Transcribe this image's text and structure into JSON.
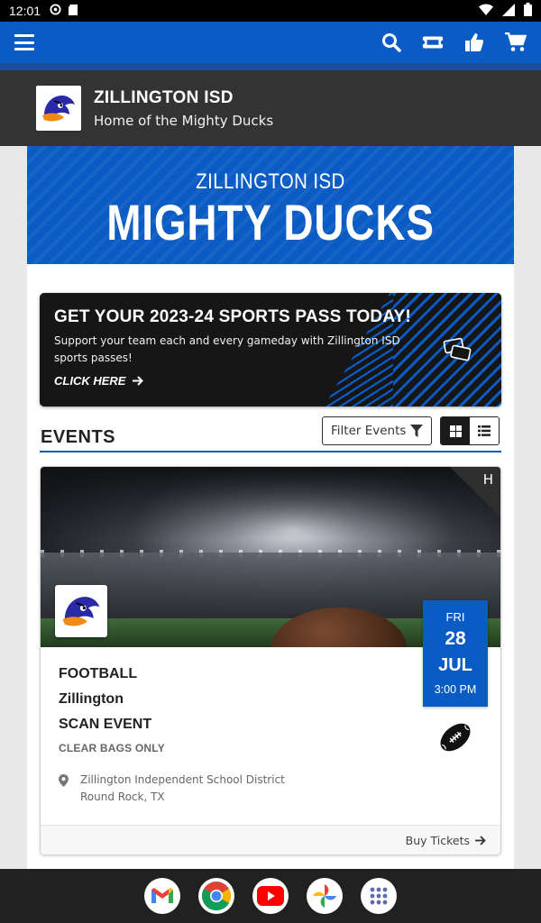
{
  "status_bar": {
    "time": "12:01"
  },
  "top_nav": {
    "icons": [
      "menu-icon",
      "search-icon",
      "ticket-icon",
      "thumbs-up-icon",
      "cart-icon"
    ]
  },
  "org": {
    "name": "ZILLINGTON ISD",
    "tagline": "Home of the Mighty Ducks"
  },
  "hero": {
    "subtitle": "ZILLINGTON ISD",
    "title": "MIGHTY DUCKS"
  },
  "promo": {
    "title": "GET YOUR 2023-24 SPORTS PASS TODAY!",
    "description": "Support your team each and every gameday with Zillington ISD sports passes!",
    "cta": "CLICK HERE"
  },
  "events": {
    "heading": "EVENTS",
    "filter_label": "Filter Events",
    "cards": [
      {
        "home_away": "H",
        "sport": "FOOTBALL",
        "opponent": "Zillington",
        "title": "SCAN EVENT",
        "note": "CLEAR BAGS ONLY",
        "date": {
          "dow": "FRI",
          "day": "28",
          "month": "JUL",
          "time": "3:00 PM"
        },
        "location_name": "Zillington Independent School District",
        "location_city": "Round Rock, TX",
        "footer_link": "Buy Tickets"
      }
    ]
  },
  "colors": {
    "brand_blue": "#0a5bc4",
    "dark": "#333333"
  },
  "dock_apps": [
    "gmail-icon",
    "chrome-icon",
    "youtube-icon",
    "photos-icon",
    "apps-icon"
  ]
}
